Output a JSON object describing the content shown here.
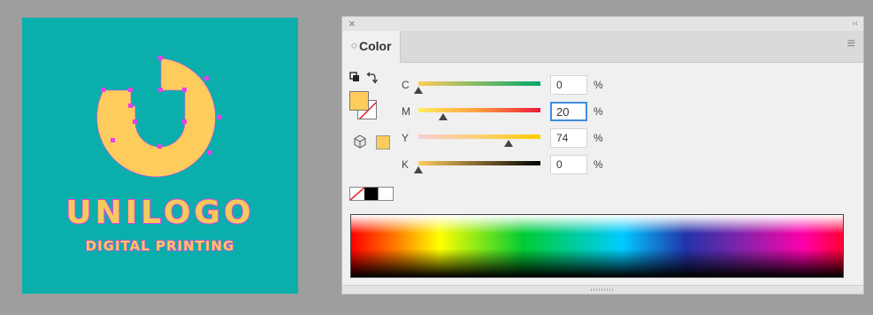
{
  "artboard": {
    "brand_name": "UNILOGO",
    "tagline": "DIGITAL PRINTING",
    "background": "#0aafac",
    "logo_color": "#fecc5c",
    "anchor_color": "#e640e6"
  },
  "panel": {
    "close_glyph": "×",
    "collapse_glyph": "‹‹",
    "tab_label": "Color",
    "menu_glyph": "≡",
    "fill_color": "#fecc5c",
    "stroke": "none",
    "channels": [
      {
        "label": "C",
        "value": "0",
        "unit": "%",
        "level": 0
      },
      {
        "label": "M",
        "value": "20",
        "unit": "%",
        "level": 20
      },
      {
        "label": "Y",
        "value": "74",
        "unit": "%",
        "level": 74
      },
      {
        "label": "K",
        "value": "0",
        "unit": "%",
        "level": 0
      }
    ],
    "focused_channel": "M",
    "icons": {
      "swap": "fill-stroke-swap-icon",
      "default": "default-colors-icon",
      "gamut": "web-safe-cube-icon",
      "menu": "panel-menu-icon"
    }
  }
}
